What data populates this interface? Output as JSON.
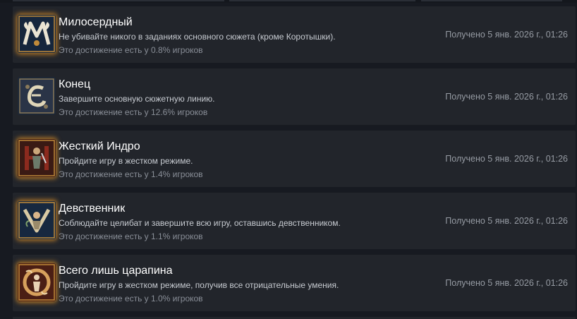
{
  "achievements": [
    {
      "title": "Милосердный",
      "description": "Не убивайте никого в заданиях основного сюжета (кроме Коротышки).",
      "percent_text": "Это достижение есть у 0.8% игроков",
      "unlocked_text": "Получено 5 янв. 2026 г., 01:26",
      "icon": "merciful-badge-icon",
      "icon_letter": "M"
    },
    {
      "title": "Конец",
      "description": "Завершите основную сюжетную линию.",
      "percent_text": "Это достижение есть у 12.6% игроков",
      "unlocked_text": "Получено 5 янв. 2026 г., 01:26",
      "icon": "the-end-badge-icon",
      "icon_letter": "E"
    },
    {
      "title": "Жесткий Индро",
      "description": "Пройдите игру в жестком режиме.",
      "percent_text": "Это достижение есть у 1.4% игроков",
      "unlocked_text": "Получено 5 янв. 2026 г., 01:26",
      "icon": "hardcore-badge-icon",
      "icon_letter": "H"
    },
    {
      "title": "Девственник",
      "description": "Соблюдайте целибат и завершите всю игру, оставшись девственником.",
      "percent_text": "Это достижение есть у 1.1% игроков",
      "unlocked_text": "Получено 5 янв. 2026 г., 01:26",
      "icon": "virgin-badge-icon",
      "icon_letter": "V"
    },
    {
      "title": "Всего лишь царапина",
      "description": "Пройдите игру в жестком режиме, получив все отрицательные умения.",
      "percent_text": "Это достижение есть у 1.0% игроков",
      "unlocked_text": "Получено 5 янв. 2026 г., 01:26",
      "icon": "scratch-badge-icon",
      "icon_letter": "O"
    }
  ],
  "colors": {
    "glow": "#e69628",
    "row_bg": "#22252b",
    "page_bg": "#171a21"
  }
}
